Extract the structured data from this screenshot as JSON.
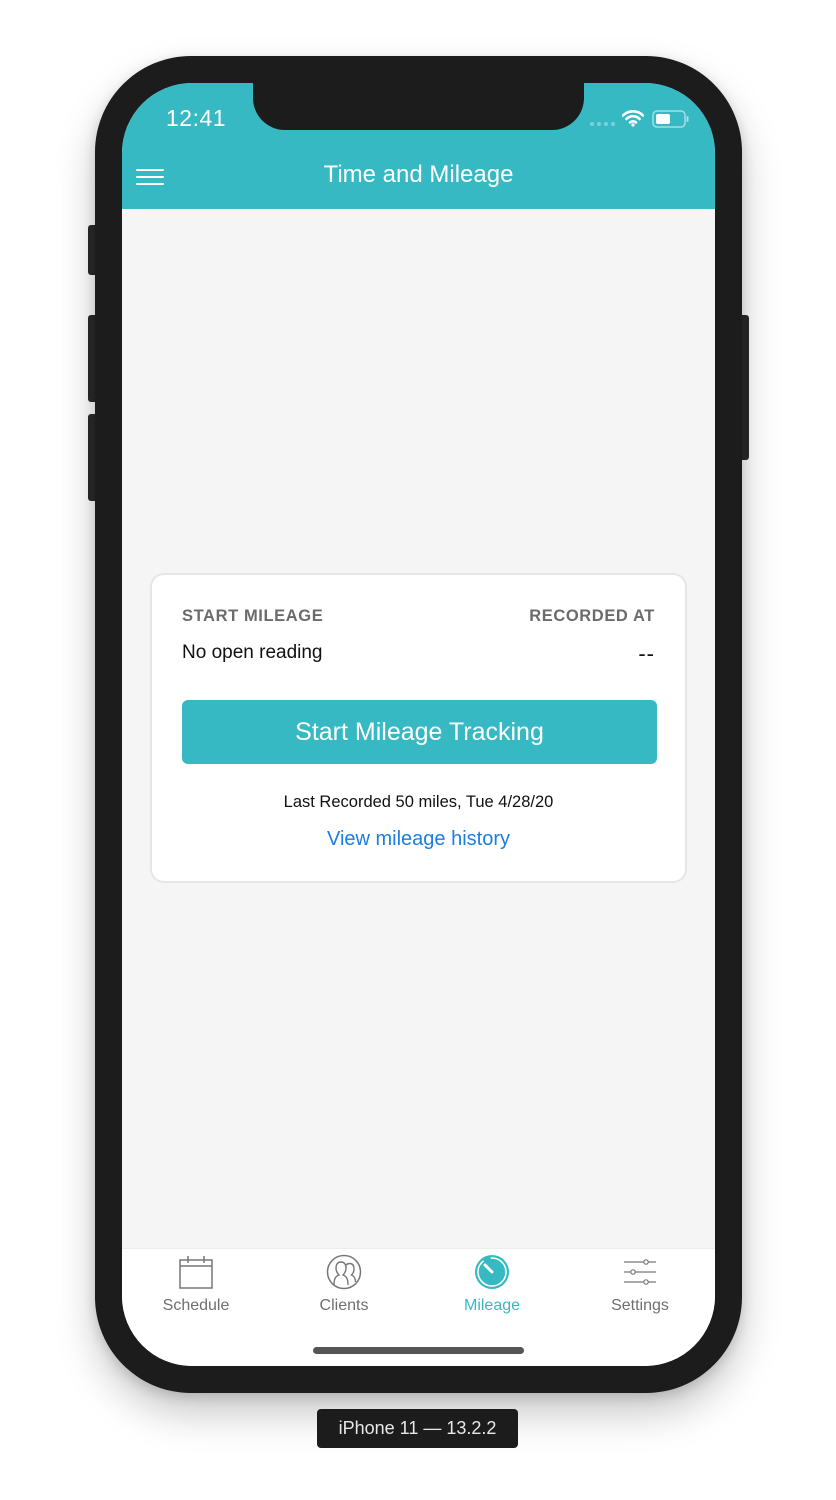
{
  "status_bar": {
    "time": "12:41"
  },
  "header": {
    "title": "Time and Mileage",
    "menu_icon": "hamburger-menu-icon"
  },
  "card": {
    "start_mileage_label": "START MILEAGE",
    "start_mileage_value": "No open reading",
    "recorded_at_label": "RECORDED AT",
    "recorded_at_value": "--",
    "start_button_label": "Start Mileage Tracking",
    "last_recorded": "Last Recorded 50 miles, Tue 4/28/20",
    "history_link": "View mileage history"
  },
  "tabbar": {
    "active": "Mileage",
    "items": [
      {
        "label": "Schedule",
        "icon": "calendar-icon"
      },
      {
        "label": "Clients",
        "icon": "clients-icon"
      },
      {
        "label": "Mileage",
        "icon": "stopwatch-icon"
      },
      {
        "label": "Settings",
        "icon": "sliders-icon"
      }
    ]
  },
  "colors": {
    "accent": "#37b9c3",
    "link": "#1a7fe0",
    "background": "#f5f5f5"
  },
  "device_caption": "iPhone 11 — 13.2.2"
}
